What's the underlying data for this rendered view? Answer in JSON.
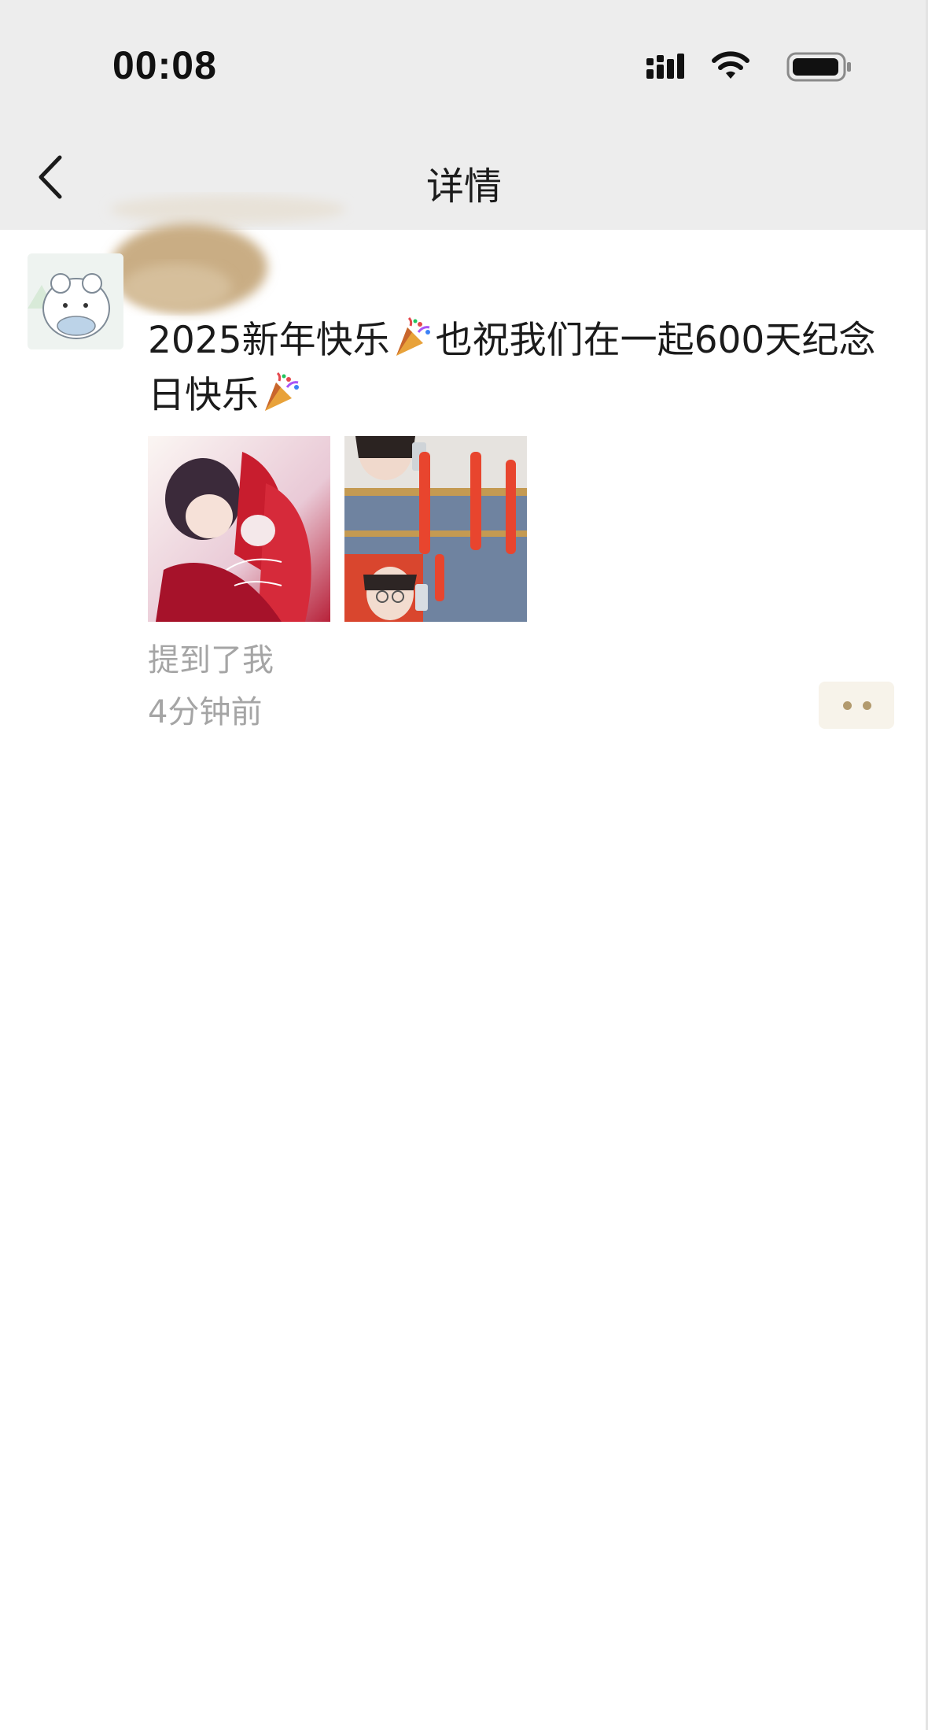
{
  "status_bar": {
    "time": "00:08",
    "icons": [
      "cellular-signal-icon",
      "wifi-icon",
      "battery-icon"
    ]
  },
  "nav": {
    "back_icon": "chevron-left-icon",
    "title": "详情"
  },
  "post": {
    "avatar": "cartoon-avatar",
    "text_part1": "2025新年快乐",
    "text_part2": "也祝我们在一起600天纪念日快乐",
    "emoji": "party-popper-icon",
    "photos": [
      "anime-couple-illustration",
      "selfie-collage-red-tassels"
    ],
    "mention_label": "提到了我",
    "time_ago": "4分钟前",
    "more_icon": "more-dots-icon"
  },
  "colors": {
    "top_bar_bg": "#ededed",
    "secondary_text": "#a5a5a5",
    "more_button_bg": "#f7f3ea",
    "more_button_dot": "#b29a6e"
  }
}
